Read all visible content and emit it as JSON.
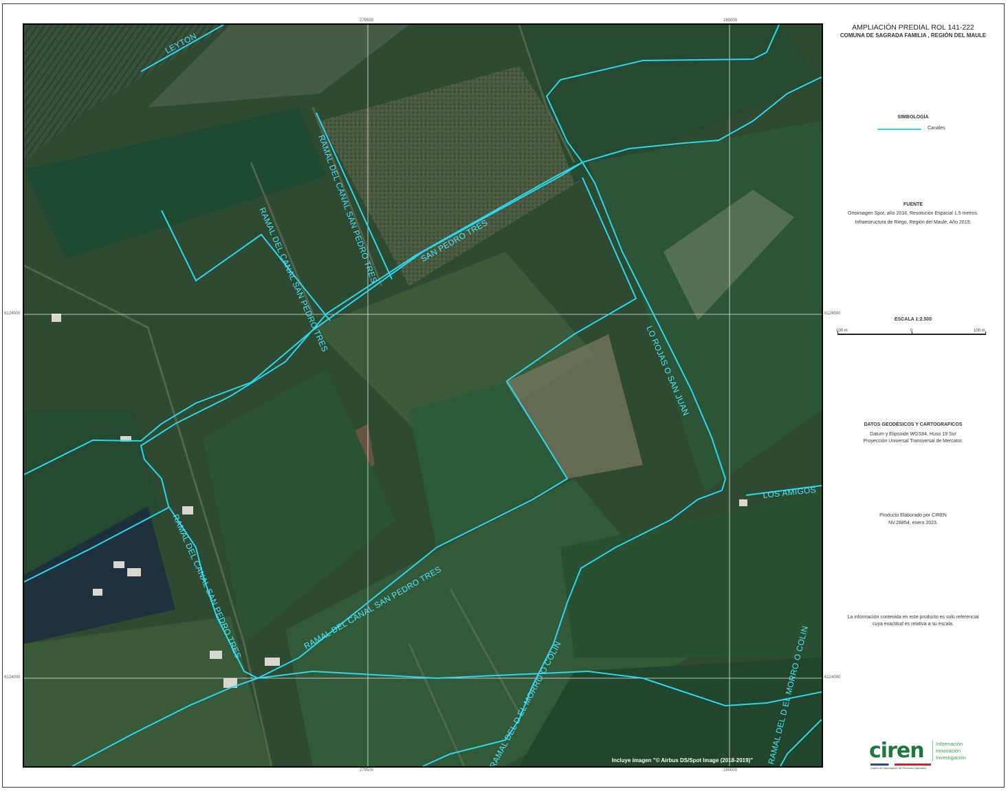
{
  "title": "AMPLIACIÓN PREDIAL  ROL 141-222",
  "subtitle": "COMUNA DE SAGRADA FAMILIA , REGIÓN DEL MAULE",
  "legend": {
    "heading": "SIMBOLOGÍA",
    "items": [
      {
        "label": "Canales",
        "color": "#29d9f0"
      }
    ]
  },
  "source": {
    "heading": "FUENTE",
    "lines": [
      "Ortoimagen Spot, año 2018, Resolución Espacial 1.5 metros.",
      "Infraestructura de Riego, Región del Maule, Año 2019."
    ]
  },
  "scale": {
    "label": "ESCALA  1:2.500",
    "left": "100 m",
    "middle": "0",
    "right": "100 m"
  },
  "geodesic": {
    "heading": "DATOS GEODÉSICOS Y CARTOGRAFICOS",
    "lines": [
      "Datum y Elipsoide WGS84, Huso 19 Sur",
      "Proyección Universal Transversal de Mercator."
    ]
  },
  "product": {
    "lines": [
      "Producto Elaborado por CIREN",
      "NV.28854, enero 2023."
    ]
  },
  "disclaimer": {
    "lines": [
      "La información contenida en este producto es solo referencial",
      "cuya exactitud es relativa a su escala."
    ]
  },
  "logo": {
    "name": "ciren",
    "tiny": "Centro de Información de Recursos Naturales",
    "taglines": [
      "Información",
      "Innovación",
      "Investigación"
    ]
  },
  "credit": "Incluye imagen \"© Airbus DS/Spot Image (2018-2019)\"",
  "grid": {
    "x_top": [
      "279500",
      "280000"
    ],
    "x_bottom": [
      "279500",
      "280000"
    ],
    "y_left": [
      "6124500",
      "6124000"
    ],
    "y_right": [
      "6124500",
      "6124000"
    ]
  },
  "canal_labels": {
    "leyton": "LEYTON",
    "ramal_spt_1": "RAMAL DEL CANAL SAN PEDRO TRES",
    "ramal_spt_2": "RAMAL DEL CANAL SAN PEDRO TRES",
    "san_pedro_tres": "SAN PEDRO TRES",
    "lo_rojas": "LO ROJAS O SAN JUAN",
    "los_amigos": "LOS AMIGOS",
    "ramal_spt_3": "RAMAL DEL CANAL SAN PEDRO TRES",
    "ramal_spt_4": "RAMAL DEL CANAL SAN PEDRO TRES",
    "ramal_morro_1": "RAMAL DEL D EL MORRO O COLIN",
    "ramal_morro_2": "RAMAL DEL D EL MORRO O COLIN"
  }
}
